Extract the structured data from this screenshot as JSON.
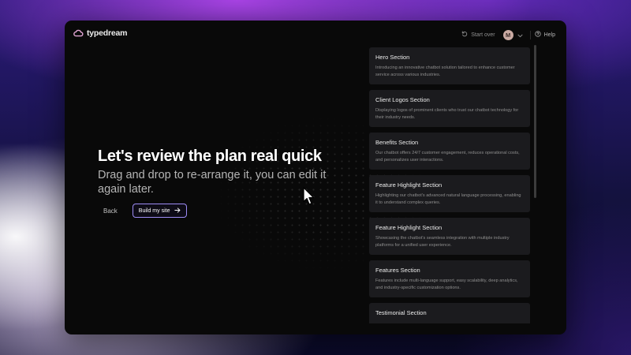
{
  "app": {
    "name": "typedream"
  },
  "header": {
    "start_over_label": "Start over",
    "avatar_initial": "M",
    "help_label": "Help"
  },
  "hero": {
    "title": "Let's review the plan real quick",
    "subtitle": "Drag and drop to re-arrange it, you can edit it again later.",
    "back_label": "Back",
    "build_label": "Build my site"
  },
  "sections": [
    {
      "title": "Hero Section",
      "description": "Introducing an innovative chatbot solution tailored to enhance customer service across various industries."
    },
    {
      "title": "Client Logos Section",
      "description": "Displaying logos of prominent clients who trust our chatbot technology for their industry needs."
    },
    {
      "title": "Benefits Section",
      "description": "Our chatbot offers 24/7 customer engagement, reduces operational costs, and personalizes user interactions."
    },
    {
      "title": "Feature Highlight Section",
      "description": "Highlighting our chatbot's advanced natural language processing, enabling it to understand complex queries."
    },
    {
      "title": "Feature Highlight Section",
      "description": "Showcasing the chatbot's seamless integration with multiple industry platforms for a unified user experience."
    },
    {
      "title": "Features Section",
      "description": "Features include multi-language support, easy scalability, deep analytics, and industry-specific customization options."
    },
    {
      "title": "Testimonial Section",
      "description": ""
    }
  ],
  "colors": {
    "accent_border": "#9d8cf5",
    "card_bg": "#1b1b1e",
    "window_bg": "#090909"
  },
  "icons": {
    "logo": "cloud-logo-icon",
    "start_over": "rotate-ccw-icon",
    "avatar_menu": "chevron-down-icon",
    "help": "help-circle-icon",
    "build": "arrow-right-icon",
    "cursor": "mouse-pointer-icon"
  }
}
